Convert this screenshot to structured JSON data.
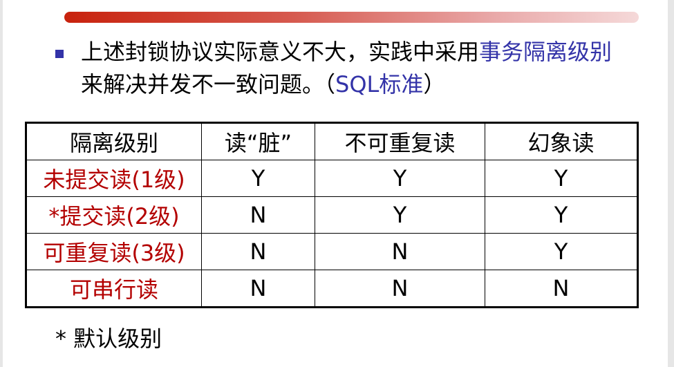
{
  "paragraph": {
    "text_before": "上述封锁协议实际意义不大，实践中采用",
    "highlight": "事务隔离级别",
    "text_middle": "来解决并发不一致问题。（",
    "standard": "SQL标准",
    "text_end": "）"
  },
  "table": {
    "headers": [
      "隔离级别",
      "读“脏”",
      "不可重复读",
      "幻象读"
    ],
    "rows": [
      {
        "level": "未提交读(1级)",
        "values": [
          "Y",
          "Y",
          "Y"
        ]
      },
      {
        "level": "*提交读(2级)",
        "values": [
          "N",
          "Y",
          "Y"
        ]
      },
      {
        "level": "可重复读(3级)",
        "values": [
          "N",
          "N",
          "Y"
        ]
      },
      {
        "level": "可串行读",
        "values": [
          "N",
          "N",
          "N"
        ]
      }
    ]
  },
  "footnote": "* 默认级别",
  "colors": {
    "accent_blue": "#3333a8",
    "level_red": "#b30000",
    "title_bar_start": "#c8220d"
  }
}
